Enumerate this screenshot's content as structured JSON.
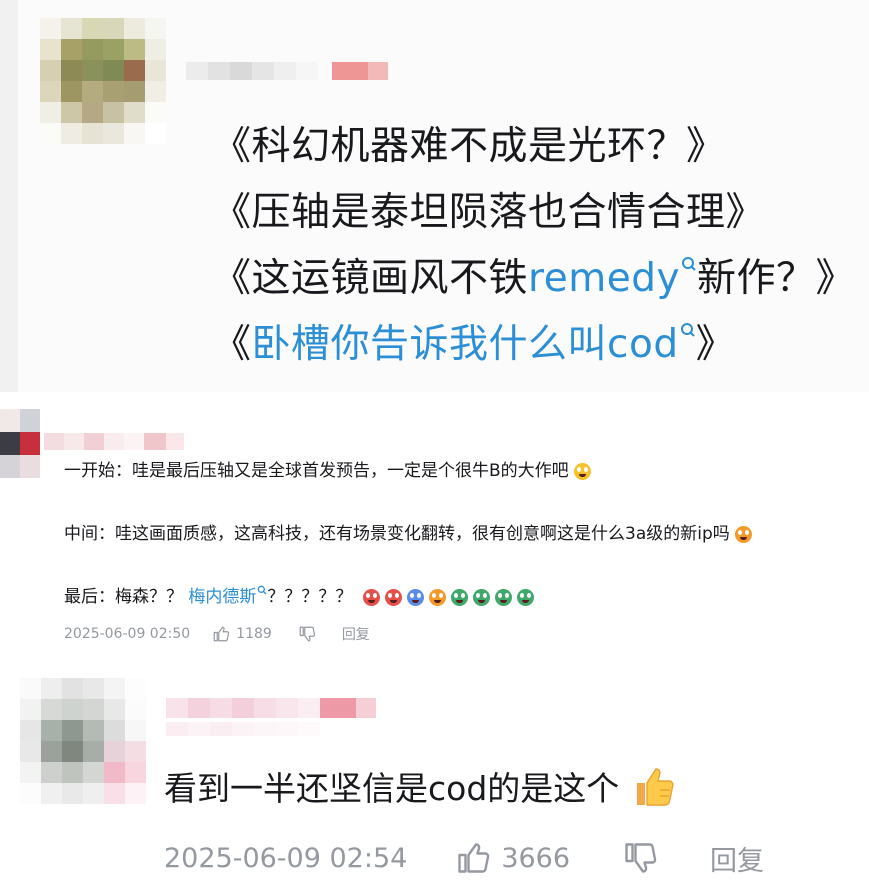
{
  "post": {
    "lines": [
      {
        "open": "《",
        "text": "科幻机器难不成是光环？",
        "close": "》"
      },
      {
        "open": "《",
        "text": "压轴是泰坦陨落也合情合理",
        "close": "》"
      },
      {
        "open": "《",
        "pre": "这运镜画风不铁",
        "link": "remedy",
        "post": "新作？",
        "close": "》"
      },
      {
        "open": "《",
        "link": "卧槽你告诉我什么叫cod",
        "close": "》"
      }
    ]
  },
  "comment": {
    "lines": [
      {
        "text": "一开始：哇是最后压轴又是全球首发预告，一定是个很牛B的大作吧",
        "emojis": [
          "grin"
        ]
      },
      {
        "text": "中间：哇这画面质感，这高科技，还有场景变化翻转，很有创意啊这是什么3a级的新ip吗",
        "emojis": [
          "shocked"
        ]
      },
      {
        "pre": "最后：梅森？？",
        "link": "梅内德斯",
        "post": "？？？？？",
        "emojis": [
          "scream",
          "scream",
          "fear",
          "dizzy",
          "sick",
          "vomit",
          "vomit",
          "vomit"
        ]
      }
    ],
    "date": "2025-06-09 02:50",
    "likes": "1189",
    "reply_label": "回复"
  },
  "reply": {
    "text": "看到一半还坚信是cod的是这个",
    "emoji": "thumbs-up",
    "date": "2025-06-09 02:54",
    "likes": "3666",
    "reply_label": "回复"
  },
  "colors": {
    "link": "#2c8fd6",
    "meta_gray": "#9499a0",
    "text": "#18191c"
  },
  "icons": [
    "search-icon",
    "thumb-up-icon",
    "thumb-down-icon",
    "thumbs-up-emoji"
  ]
}
